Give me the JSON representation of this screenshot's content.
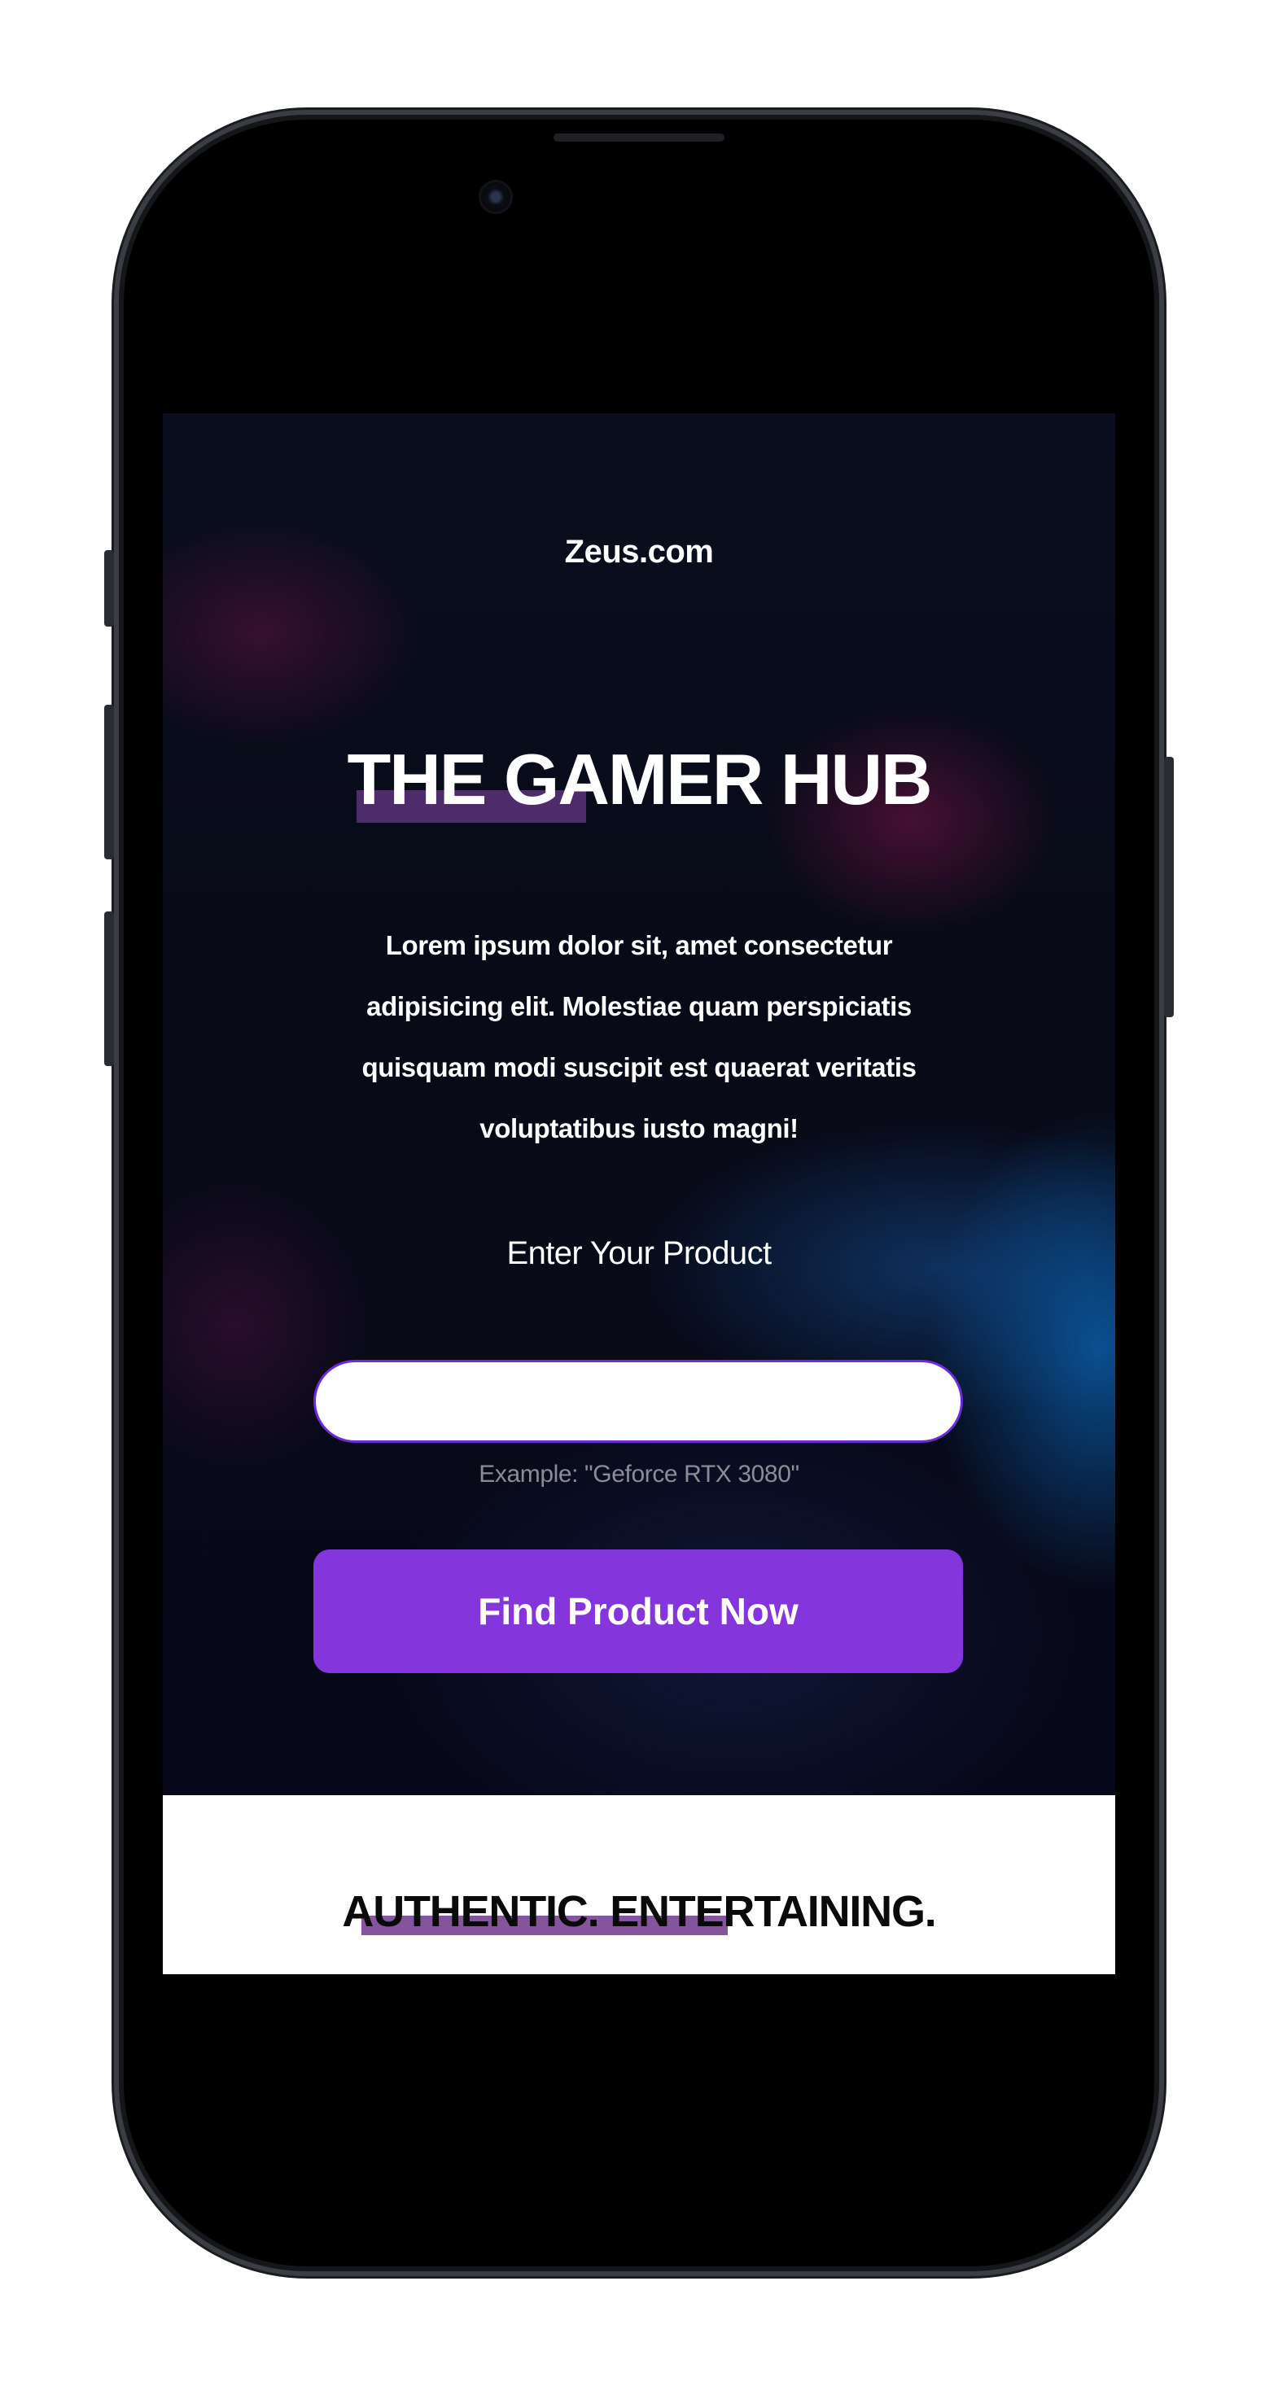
{
  "brand": "Zeus.com",
  "hero": {
    "title": "THE GAMER HUB",
    "description": "Lorem ipsum dolor sit, amet consectetur adipisicing elit. Molestiae quam perspiciatis quisquam modi suscipit est quaerat veritatis voluptatibus iusto magni!"
  },
  "form": {
    "label": "Enter Your Product",
    "input_value": "",
    "hint": "Example: \"Geforce RTX 3080\"",
    "submit_label": "Find Product Now"
  },
  "section2": {
    "tagline": "AUTHENTIC. ENTERTAINING."
  },
  "colors": {
    "accent": "#8435dc",
    "input_border": "#6a2bd9",
    "underline": "#88489f",
    "hero_background": "#080a17"
  }
}
